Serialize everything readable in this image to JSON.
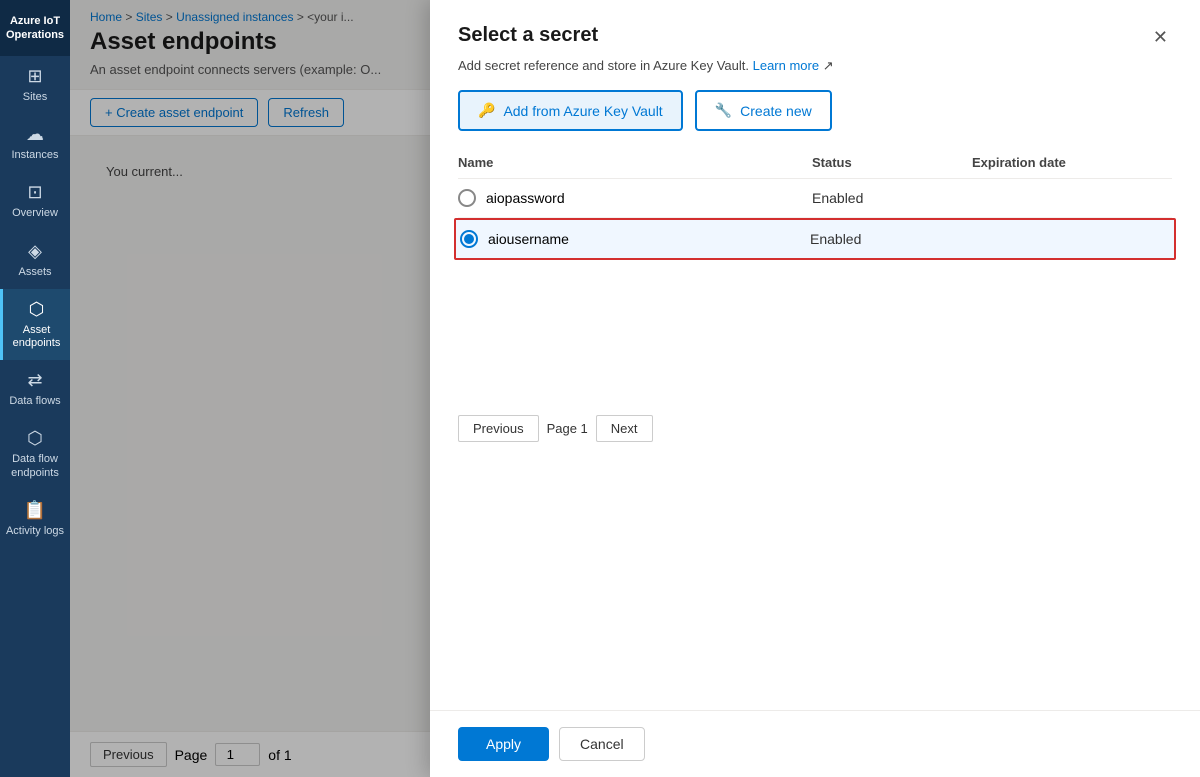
{
  "app": {
    "title": "Azure IoT Operations"
  },
  "sidebar": {
    "items": [
      {
        "id": "sites",
        "label": "Sites",
        "icon": "⊞"
      },
      {
        "id": "instances",
        "label": "Instances",
        "icon": "☁"
      },
      {
        "id": "overview",
        "label": "Overview",
        "icon": "⊡"
      },
      {
        "id": "assets",
        "label": "Assets",
        "icon": "◈"
      },
      {
        "id": "asset-endpoints",
        "label": "Asset endpoints",
        "icon": "⬡",
        "active": true
      },
      {
        "id": "data-flows",
        "label": "Data flows",
        "icon": "⇄"
      },
      {
        "id": "data-flow-endpoints",
        "label": "Data flow endpoints",
        "icon": "⬡"
      },
      {
        "id": "activity-logs",
        "label": "Activity logs",
        "icon": "📋"
      }
    ]
  },
  "breadcrumb": {
    "parts": [
      "Home",
      "Sites",
      "Unassigned instances",
      "<your i..."
    ]
  },
  "page": {
    "title": "Asset endpoints",
    "subtitle": "An asset endpoint connects servers (example: O...",
    "info_banner": "You current...",
    "create_button": "+ Create asset endpoint",
    "refresh_button": "Refresh"
  },
  "pagination": {
    "previous_label": "Previous",
    "page_label": "Page",
    "page_value": "1",
    "of_label": "of 1"
  },
  "modal": {
    "title": "Select a secret",
    "subtitle": "Add secret reference and store in Azure Key Vault.",
    "learn_more": "Learn more",
    "close_icon": "✕",
    "add_from_vault_label": "Add from Azure Key Vault",
    "create_new_label": "Create new",
    "table": {
      "columns": [
        "Name",
        "Status",
        "Expiration date"
      ],
      "rows": [
        {
          "name": "aiopassword",
          "status": "Enabled",
          "expiration": "",
          "selected": false
        },
        {
          "name": "aiousername",
          "status": "Enabled",
          "expiration": "",
          "selected": true
        }
      ]
    },
    "pagination": {
      "previous_label": "Previous",
      "page_indicator": "Page 1",
      "next_label": "Next"
    },
    "footer": {
      "apply_label": "Apply",
      "cancel_label": "Cancel"
    }
  }
}
